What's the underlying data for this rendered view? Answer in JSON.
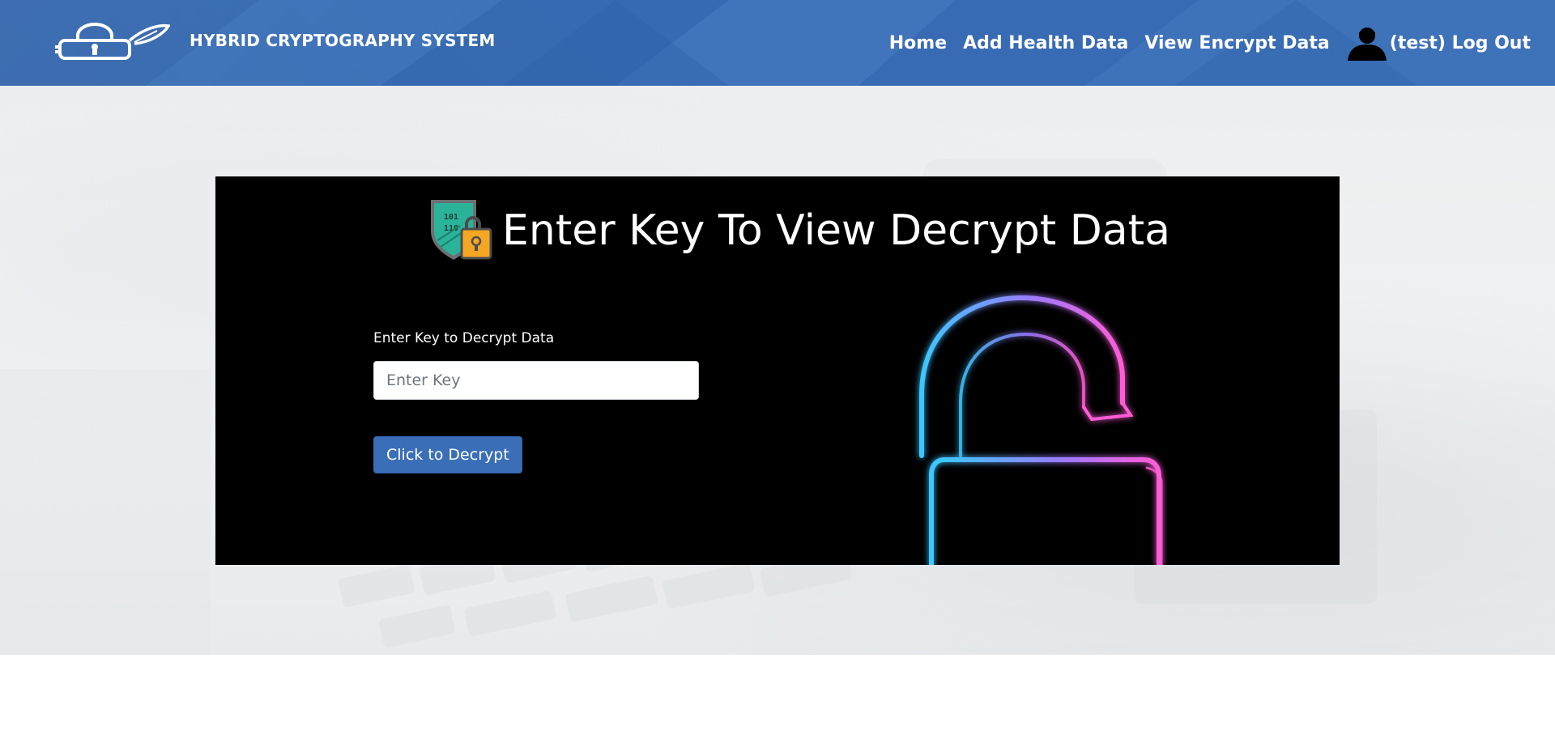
{
  "header": {
    "brand_title": "HYBRID CRYPTOGRAPHY SYSTEM",
    "nav": {
      "home": "Home",
      "add_health_data": "Add Health Data",
      "view_encrypt_data": "View Encrypt Data",
      "logout": "(test) Log Out"
    }
  },
  "panel": {
    "title": "Enter Key To View Decrypt Data",
    "field_label": "Enter Key to Decrypt Data",
    "input_value": "",
    "input_placeholder": "Enter Key",
    "button_label": "Click to Decrypt"
  },
  "icons": {
    "brand": "lock-feather-logo-icon",
    "user": "user-icon",
    "shield": "binary-shield-padlock-icon",
    "neon": "neon-unlocked-padlock-icon"
  },
  "colors": {
    "header_bg": "#3b6fb6",
    "button_bg": "#3a6fb8",
    "panel_bg": "#000000",
    "neon_blue": "#3ec6ff",
    "neon_pink": "#ff5cd6"
  }
}
